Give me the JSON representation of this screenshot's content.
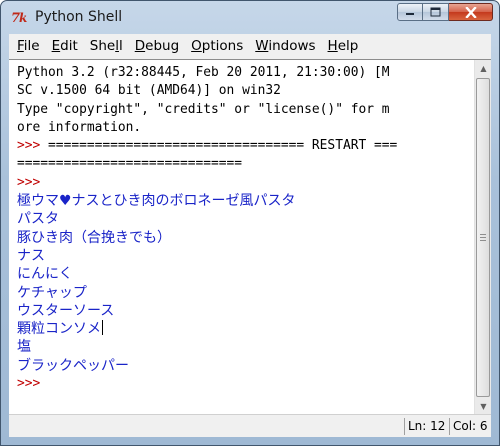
{
  "window": {
    "title": "Python Shell",
    "app_icon": "python-idle-icon"
  },
  "caption_buttons": {
    "minimize_icon": "minimize-icon",
    "maximize_icon": "maximize-icon",
    "close_icon": "close-icon"
  },
  "menu": [
    {
      "label": "File",
      "accel": "F"
    },
    {
      "label": "Edit",
      "accel": "E"
    },
    {
      "label": "Shell",
      "accel": "l"
    },
    {
      "label": "Debug",
      "accel": "D"
    },
    {
      "label": "Options",
      "accel": "O"
    },
    {
      "label": "Windows",
      "accel": "W"
    },
    {
      "label": "Help",
      "accel": "H"
    }
  ],
  "shell": {
    "banner": [
      "Python 3.2 (r32:88445, Feb 20 2011, 21:30:00) [M",
      "SC v.1500 64 bit (AMD64)] on win32",
      "Type \"copyright\", \"credits\" or \"license()\" for m",
      "ore information."
    ],
    "restart_prompt": ">>> ",
    "restart_line_1": "================================= RESTART ===",
    "restart_line_2": "=============================",
    "prompt": ">>>",
    "output_lines": [
      "極ウマ♥ナスとひき肉のボロネーゼ風パスタ",
      "パスタ",
      "豚ひき肉（合挽きでも）",
      "ナス",
      "にんにく",
      "ケチャップ",
      "ウスターソース",
      "顆粒コンソメ",
      "塩",
      "ブラックペッパー"
    ],
    "final_prompt": ">>>"
  },
  "status": {
    "line": "Ln: 12",
    "col": "Col: 6"
  },
  "colors": {
    "prompt": "#c00000",
    "output": "#1a24c8",
    "text": "#000000"
  }
}
